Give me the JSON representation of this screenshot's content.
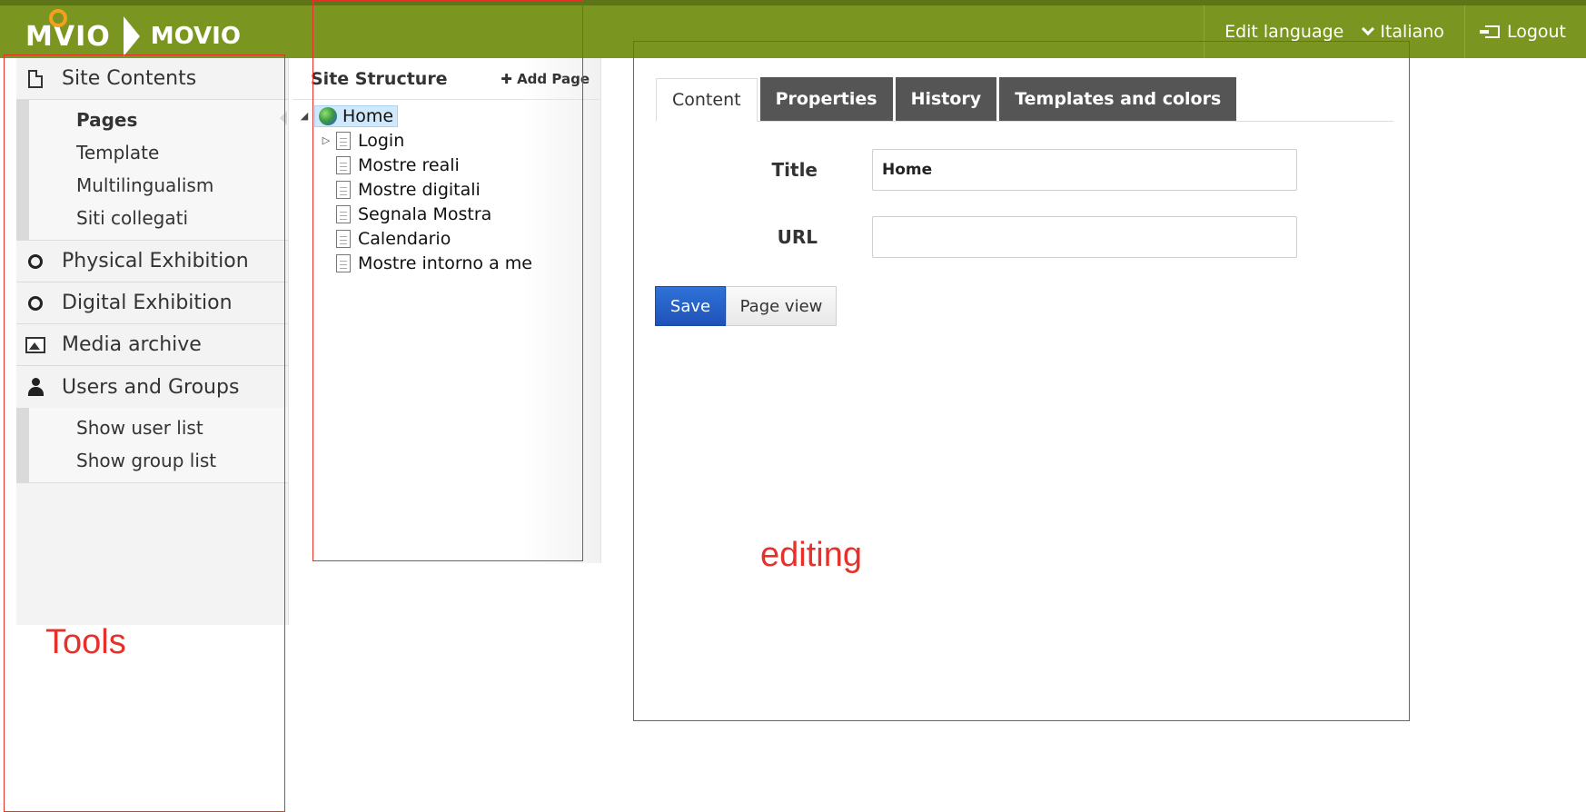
{
  "header": {
    "logo_text": "MVIO",
    "app_title": "MOVIO",
    "edit_language_label": "Edit language",
    "language_value": "Italiano",
    "logout_label": "Logout"
  },
  "sidebar": {
    "site_contents": "Site Contents",
    "site_contents_items": [
      "Pages",
      "Template",
      "Multilingualism",
      "Siti collegati"
    ],
    "physical_exhibition": "Physical Exhibition",
    "digital_exhibition": "Digital Exhibition",
    "media_archive": "Media archive",
    "users_and_groups": "Users and Groups",
    "users_items": [
      "Show user list",
      "Show group list"
    ]
  },
  "structure": {
    "title": "Site Structure",
    "add_page": "Add Page",
    "root": "Home",
    "children": [
      "Login",
      "Mostre reali",
      "Mostre digitali",
      "Segnala Mostra",
      "Calendario",
      "Mostre intorno a me"
    ]
  },
  "editor": {
    "tabs": [
      "Content",
      "Properties",
      "History",
      "Templates and colors"
    ],
    "title_label": "Title",
    "title_value": "Home",
    "url_label": "URL",
    "url_value": "",
    "save_label": "Save",
    "page_view_label": "Page view"
  },
  "annotations": {
    "tools": "Tools",
    "editing": "editing",
    "color": "#e8302a"
  },
  "colors": {
    "header_green": "#7b9620",
    "save_blue": "#2f72d8",
    "tab_dark": "#555555"
  }
}
